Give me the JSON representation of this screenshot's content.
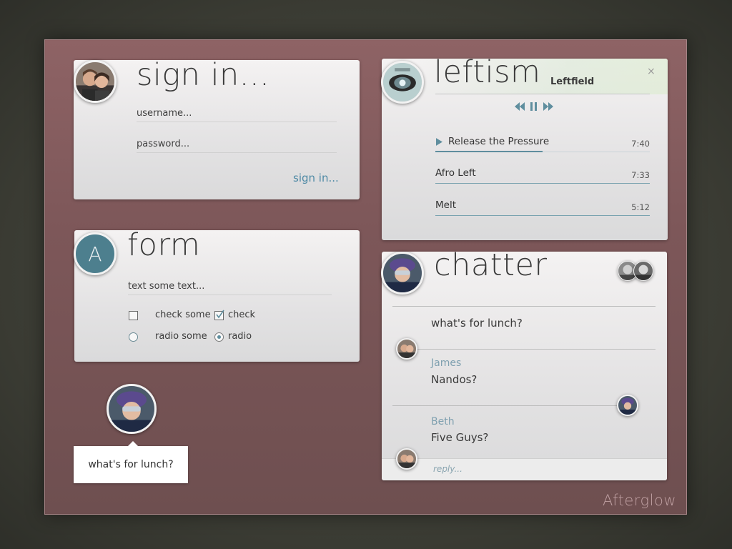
{
  "signin": {
    "title": "sign in...",
    "username_placeholder": "username...",
    "password_placeholder": "password...",
    "submit_label": "sign in..."
  },
  "form": {
    "avatar_letter": "A",
    "title": "form",
    "text_placeholder": "text some text...",
    "checkbox1_label": "check some",
    "checkbox2_label": "check",
    "radio1_label": "radio some",
    "radio2_label": "radio"
  },
  "music": {
    "title": "leftism",
    "artist": "Leftfield",
    "tracks": [
      {
        "name": "Release the Pressure",
        "time": "7:40"
      },
      {
        "name": "Afro Left",
        "time": "7:33"
      },
      {
        "name": "Melt",
        "time": "5:12"
      }
    ],
    "icons": [
      "rewind-icon",
      "pause-icon",
      "fast-forward-icon",
      "close-icon",
      "play-icon"
    ]
  },
  "chatter": {
    "title": "chatter",
    "messages": [
      {
        "name": "",
        "text": "what's for lunch?"
      },
      {
        "name": "James",
        "text": "Nandos?"
      },
      {
        "name": "Beth",
        "text": "Five Guys?"
      }
    ],
    "reply_placeholder": "reply..."
  },
  "tooltip": {
    "text": "what's for lunch?"
  },
  "brand": "Afterglow",
  "colors": {
    "accent": "#4e8aa5",
    "board": "#7d5759",
    "panel": "#e3e2e3",
    "avatar_letter_bg": "#4d7f8e"
  }
}
